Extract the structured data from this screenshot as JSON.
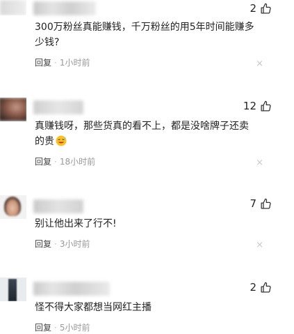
{
  "comments": [
    {
      "likes": "2",
      "text": "300万粉丝真能赚钱，千万粉丝的用5年时间能赚多少钱?",
      "reply_label": "回复",
      "separator": "·",
      "time": "1小时前",
      "emoji": ""
    },
    {
      "likes": "12",
      "text": "真赚钱呀，那些货真的看不上，都是没啥牌子还卖的贵",
      "reply_label": "回复",
      "separator": "·",
      "time": "18小时前",
      "emoji": "sweat-laugh-emoji"
    },
    {
      "likes": "7",
      "text": "别让他出来了行不!",
      "reply_label": "回复",
      "separator": "·",
      "time": "3小时前",
      "emoji": ""
    },
    {
      "likes": "2",
      "text": "怪不得大家都想当网红主播",
      "reply_label": "回复",
      "separator": "·",
      "time": "5小时前",
      "emoji": ""
    }
  ],
  "icons": {
    "like": "thumbs-up-icon",
    "close": "close-icon",
    "close_glyph": "×"
  },
  "colors": {
    "text": "#222222",
    "meta": "#999999",
    "close": "#c8c8c8"
  }
}
